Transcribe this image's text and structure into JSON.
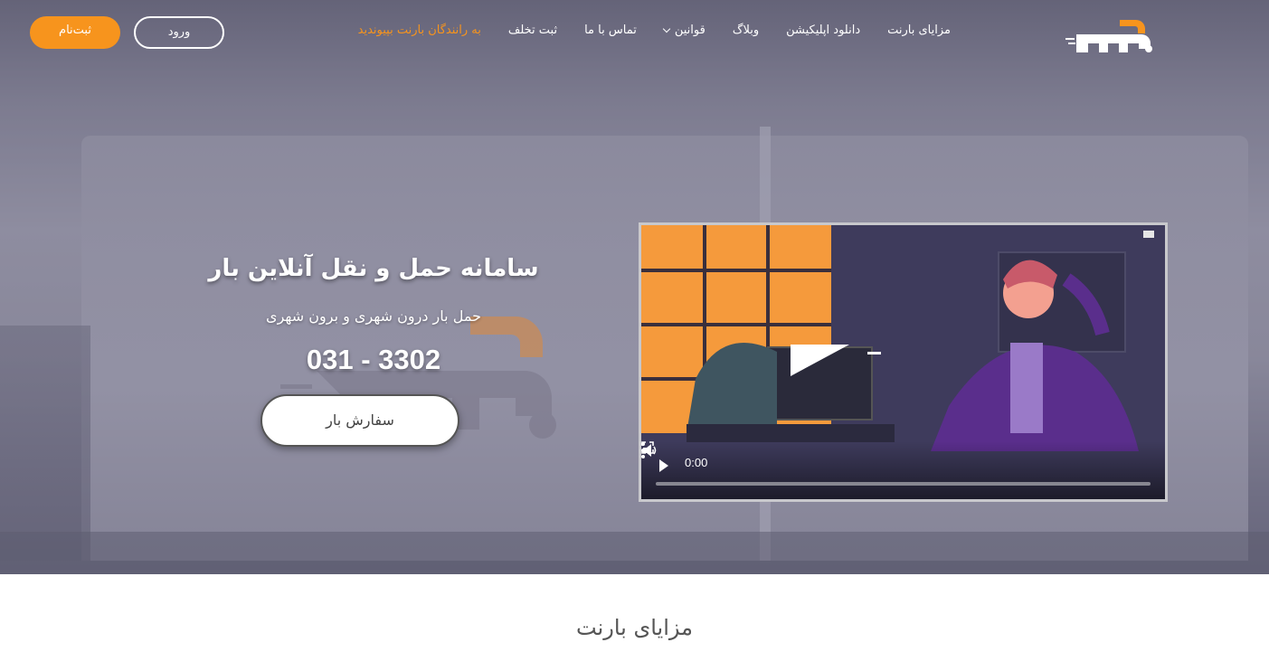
{
  "nav": {
    "register_label": "ثبت‌نام",
    "login_label": "ورود",
    "menu": [
      {
        "label": "مزایای بارنت"
      },
      {
        "label": "دانلود اپلیکیشن"
      },
      {
        "label": "وبلاگ"
      },
      {
        "label": "قوانین"
      },
      {
        "label": "تماس با ما"
      },
      {
        "label": "ثبت تخلف"
      },
      {
        "label": "به رانندگان بارنت بپیوندید"
      }
    ],
    "brand_icon": "barnet-logo"
  },
  "hero": {
    "title": "سامانه حمل و نقل آنلاین بار",
    "subtitle": "حمل بار درون شهری و برون شهری",
    "phone": "031 - 3302",
    "order_button": "سفارش بار"
  },
  "video": {
    "time": "0:00",
    "progress": 0
  },
  "section": {
    "title": "مزایای بارنت"
  },
  "colors": {
    "accent": "#f7941d",
    "white": "#ffffff"
  }
}
